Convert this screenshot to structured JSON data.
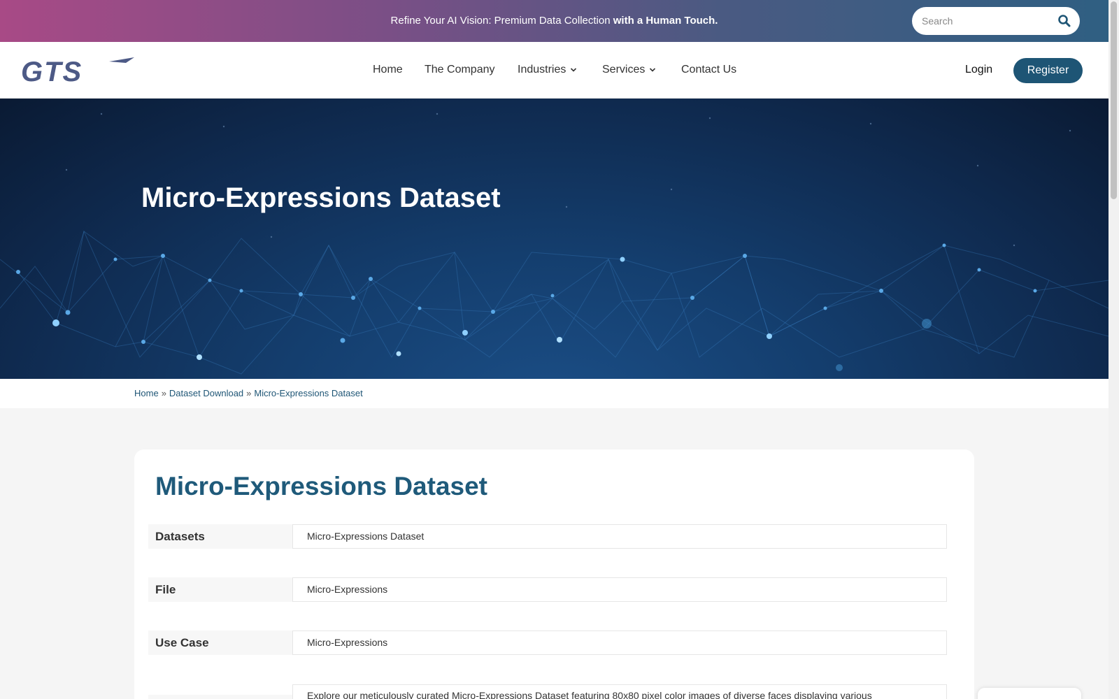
{
  "topbar": {
    "message_prefix": "Refine Your AI Vision: Premium Data Collection ",
    "message_bold": "with a Human Touch.",
    "search_placeholder": "Search"
  },
  "nav": {
    "logo_text": "GTS",
    "items": [
      {
        "label": "Home"
      },
      {
        "label": "The Company"
      },
      {
        "label": "Industries"
      },
      {
        "label": "Services"
      },
      {
        "label": "Contact Us"
      }
    ],
    "login": "Login",
    "register": "Register"
  },
  "hero": {
    "title": "Micro-Expressions Dataset"
  },
  "breadcrumb": {
    "items": [
      "Home",
      "Dataset Download",
      "Micro-Expressions Dataset"
    ],
    "separator": "»"
  },
  "main": {
    "title": "Micro-Expressions Dataset",
    "rows": [
      {
        "label": "Datasets",
        "value": "Micro-Expressions Dataset"
      },
      {
        "label": "File",
        "value": "Micro-Expressions"
      },
      {
        "label": "Use Case",
        "value": "Micro-Expressions"
      },
      {
        "label": "",
        "value": "Explore our meticulously curated Micro-Expressions Dataset featuring 80x80 pixel color images of diverse faces displaying various"
      }
    ]
  },
  "colors": {
    "brand": "#1e5575",
    "title": "#1f5a7a",
    "topbar_start": "#a84a86",
    "topbar_end": "#2f5f82"
  }
}
